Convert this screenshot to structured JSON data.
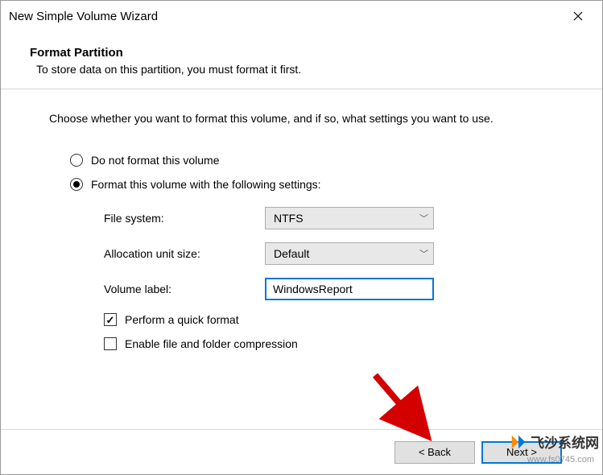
{
  "window": {
    "title": "New Simple Volume Wizard"
  },
  "header": {
    "title": "Format Partition",
    "subtitle": "To store data on this partition, you must format it first."
  },
  "instruction": "Choose whether you want to format this volume, and if so, what settings you want to use.",
  "radios": {
    "no_format": "Do not format this volume",
    "format_with": "Format this volume with the following settings:"
  },
  "settings": {
    "file_system_label": "File system:",
    "file_system_value": "NTFS",
    "allocation_label": "Allocation unit size:",
    "allocation_value": "Default",
    "volume_label_label": "Volume label:",
    "volume_label_value": "WindowsReport"
  },
  "checkboxes": {
    "quick_format": "Perform a quick format",
    "compression": "Enable file and folder compression"
  },
  "buttons": {
    "back": "< Back",
    "next": "Next >"
  },
  "watermark": {
    "text": "飞沙系统网",
    "url": "www.fs0745.com"
  }
}
